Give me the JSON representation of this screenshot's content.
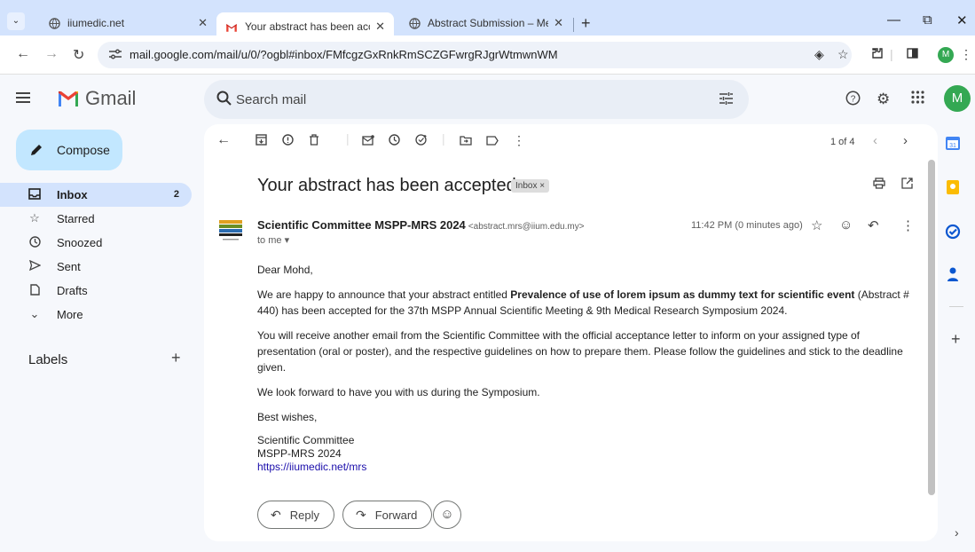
{
  "browser": {
    "tabs": [
      {
        "title": "iiumedic.net",
        "active": false
      },
      {
        "title": "Your abstract has been accepte",
        "active": true
      },
      {
        "title": "Abstract Submission – Medical",
        "active": false
      }
    ],
    "url": "mail.google.com/mail/u/0/?ogbl#inbox/FMfcgzGxRnkRmSCZGFwrgRJgrWtmwnWM",
    "profile_initial": "M"
  },
  "gmail": {
    "app_name": "Gmail",
    "search_placeholder": "Search mail",
    "account_initial": "M",
    "compose_label": "Compose",
    "nav": [
      {
        "label": "Inbox",
        "icon": "inbox-icon",
        "count": "2",
        "selected": true
      },
      {
        "label": "Starred",
        "icon": "star-icon",
        "count": "",
        "selected": false
      },
      {
        "label": "Snoozed",
        "icon": "clock-icon",
        "count": "",
        "selected": false
      },
      {
        "label": "Sent",
        "icon": "send-icon",
        "count": "",
        "selected": false
      },
      {
        "label": "Drafts",
        "icon": "draft-icon",
        "count": "",
        "selected": false
      },
      {
        "label": "More",
        "icon": "chevron-down-icon",
        "count": "",
        "selected": false
      }
    ],
    "labels_heading": "Labels"
  },
  "email": {
    "pager": "1 of 4",
    "subject": "Your abstract has been accepted",
    "label_chip": "Inbox ×",
    "sender_name": "Scientific Committee MSPP-MRS 2024",
    "sender_email": "<abstract.mrs@iium.edu.my>",
    "to_line": "to me ▾",
    "time": "11:42 PM (0 minutes ago)",
    "greeting": "Dear Mohd,",
    "p1_before": "We are happy to announce that your abstract entitled ",
    "p1_bold": "Prevalence of use of lorem ipsum as dummy text for scientific event",
    "p1_after": " (Abstract # 440) has been accepted for the 37th MSPP Annual Scientific Meeting & 9th Medical Research Symposium 2024.",
    "p2": "You will receive another email from the Scientific Committee with the official acceptance letter to inform on your assigned type of presentation (oral or poster), and the respective guidelines on how to prepare them. Please follow the guidelines and stick to the deadline given.",
    "p3": "We look forward to have you with us during the Symposium.",
    "closing": "Best wishes,",
    "sig_line1": "Scientific Committee",
    "sig_line2": "MSPP-MRS 2024",
    "sig_link": "https://iiumedic.net/mrs",
    "reply_label": "Reply",
    "forward_label": "Forward"
  },
  "colors": {
    "accent_blue": "#0b57d0",
    "compose_bg": "#c2e7ff",
    "selected_nav": "#d3e3fd",
    "avatar_green": "#34a853"
  }
}
